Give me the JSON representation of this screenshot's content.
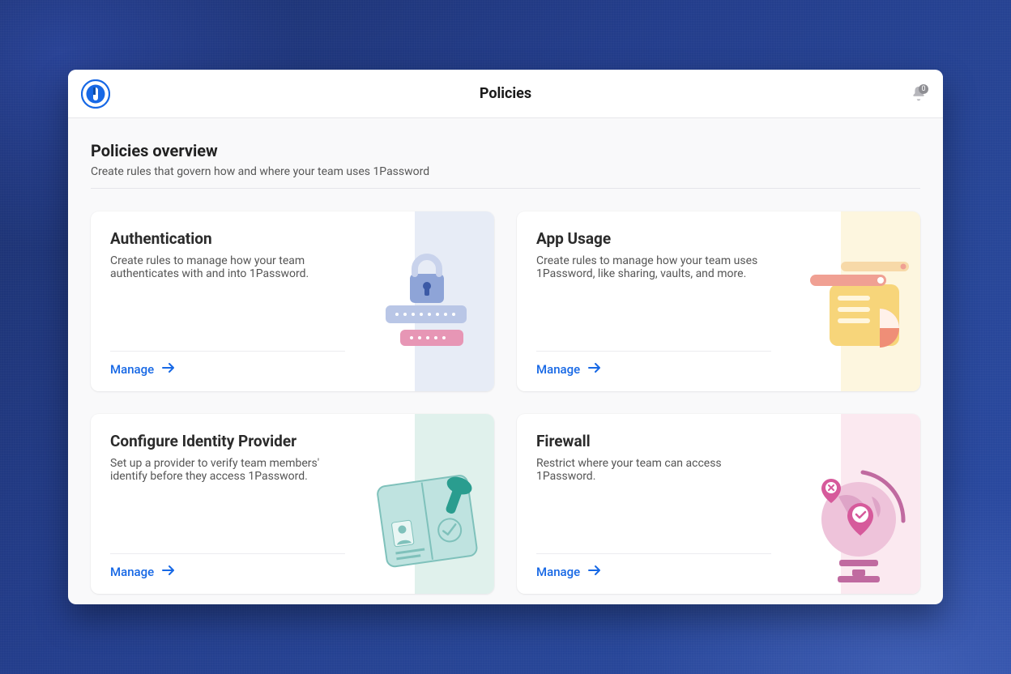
{
  "header": {
    "title": "Policies",
    "notification_count": "0"
  },
  "overview": {
    "title": "Policies overview",
    "subtitle": "Create rules that govern how and where your team uses 1Password"
  },
  "cards": {
    "auth": {
      "title": "Authentication",
      "desc": "Create rules to manage how your team authenticates with and into 1Password.",
      "action": "Manage"
    },
    "app": {
      "title": "App Usage",
      "desc": "Create rules to manage how your team uses 1Password, like sharing, vaults, and more.",
      "action": "Manage"
    },
    "idp": {
      "title": "Configure Identity Provider",
      "desc": "Set up a provider to verify team members' identify before they access 1Password.",
      "action": "Manage"
    },
    "fw": {
      "title": "Firewall",
      "desc": "Restrict where your team can access 1Password.",
      "action": "Manage"
    }
  }
}
